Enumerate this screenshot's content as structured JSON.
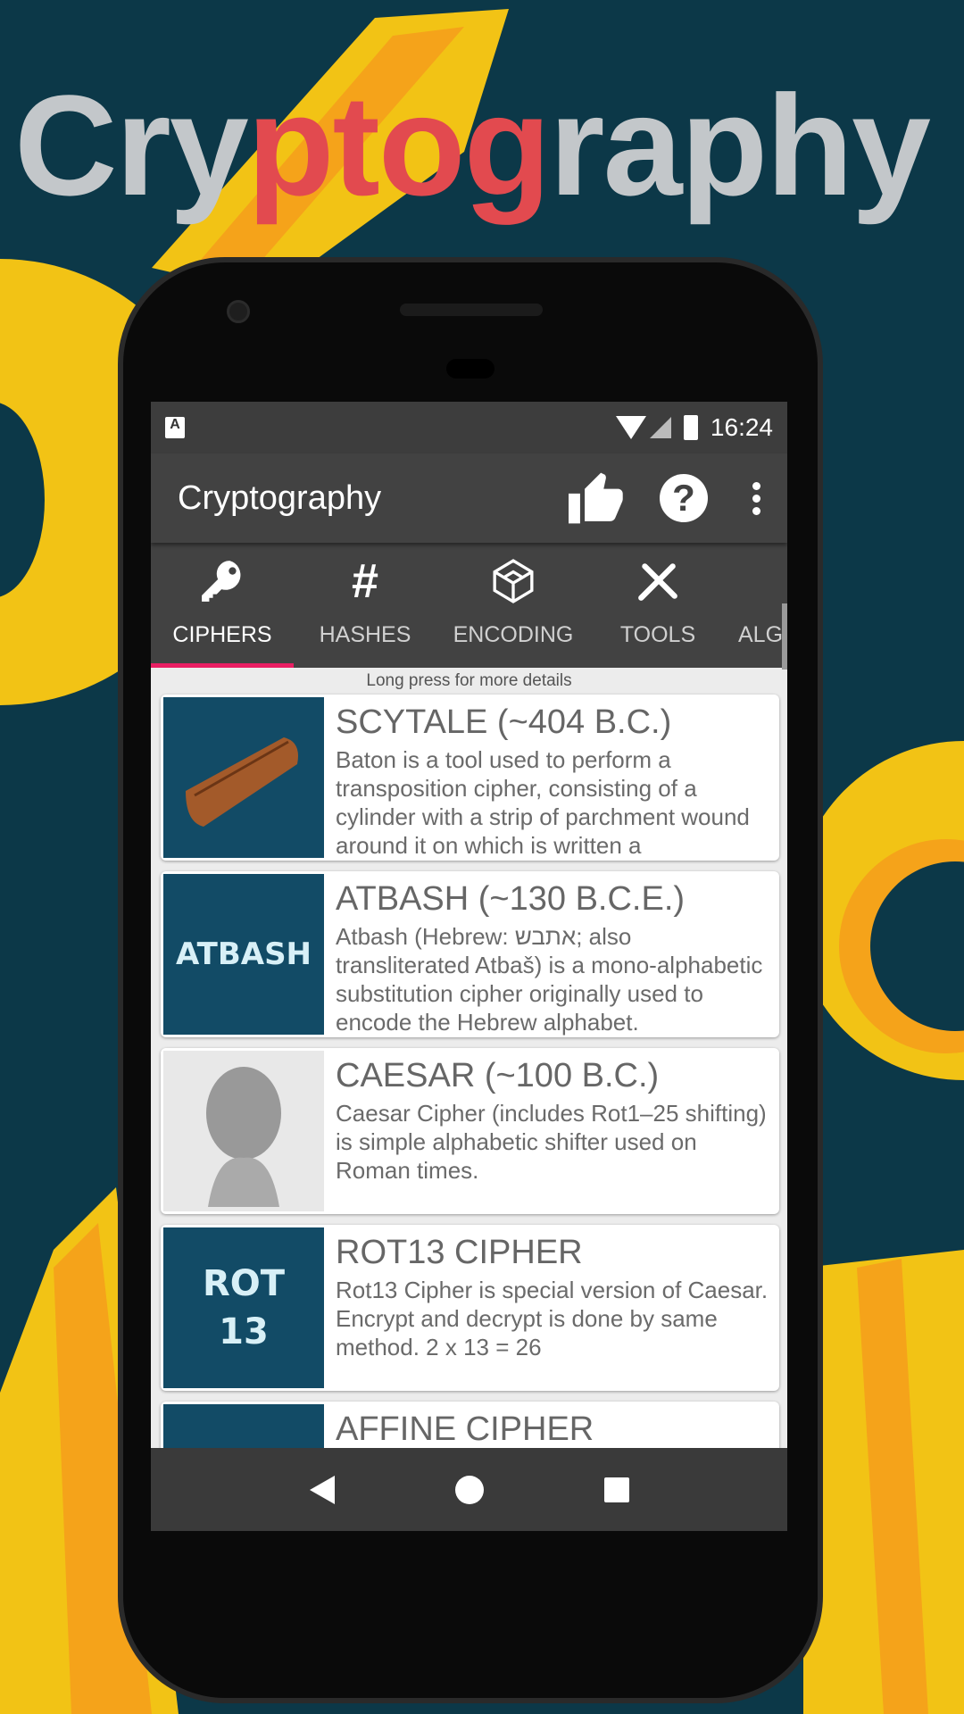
{
  "promo": {
    "title_part1": "Cry",
    "title_part2": "ptog",
    "title_part3": "raphy"
  },
  "colors": {
    "background": "#0c3848",
    "yellow": "#f2c315",
    "orange": "#f5a31a",
    "accent": "#e91e63",
    "promo_red": "#e24a4f"
  },
  "status_bar": {
    "time": "16:24",
    "icons": [
      "notification-a-icon",
      "wifi-icon",
      "signal-icon",
      "battery-charging-icon"
    ]
  },
  "toolbar": {
    "title": "Cryptography",
    "actions": [
      "thumbs-up-icon",
      "help-icon",
      "more-vert-icon"
    ]
  },
  "tabs": [
    {
      "label": "CIPHERS",
      "icon": "key-icon",
      "active": true
    },
    {
      "label": "HASHES",
      "icon": "hash-icon",
      "active": false
    },
    {
      "label": "ENCODING",
      "icon": "cube-icon",
      "active": false
    },
    {
      "label": "TOOLS",
      "icon": "tools-icon",
      "active": false
    },
    {
      "label": "ALG",
      "icon": "",
      "active": false
    }
  ],
  "hint": "Long press for more details",
  "items": [
    {
      "title": "SCYTALE (~404 B.C.)",
      "description": "Baton is a tool used to perform a transposition cipher, consisting of a cylinder with a strip of parchment wound around it on which is written a",
      "image_label": ""
    },
    {
      "title": "ATBASH (~130 B.C.E.)",
      "description": "Atbash (Hebrew: אתבש; also transliterated Atbaš) is a mono-alphabetic substitution cipher originally used to encode the Hebrew alphabet.",
      "image_label": "ATBASH"
    },
    {
      "title": "CAESAR (~100 B.C.)",
      "description": "Caesar Cipher (includes Rot1–25 shifting) is simple alphabetic shifter used on Roman times.",
      "image_label": ""
    },
    {
      "title": "ROT13 CIPHER",
      "description": "Rot13 Cipher is special version of Caesar. Encrypt and decrypt is done by same method. 2 x 13 = 26",
      "image_label": "ROT 13"
    },
    {
      "title": "AFFINE CIPHER",
      "description": "",
      "image_label": ""
    }
  ],
  "navbar": [
    "back-icon",
    "home-icon",
    "recents-icon"
  ]
}
